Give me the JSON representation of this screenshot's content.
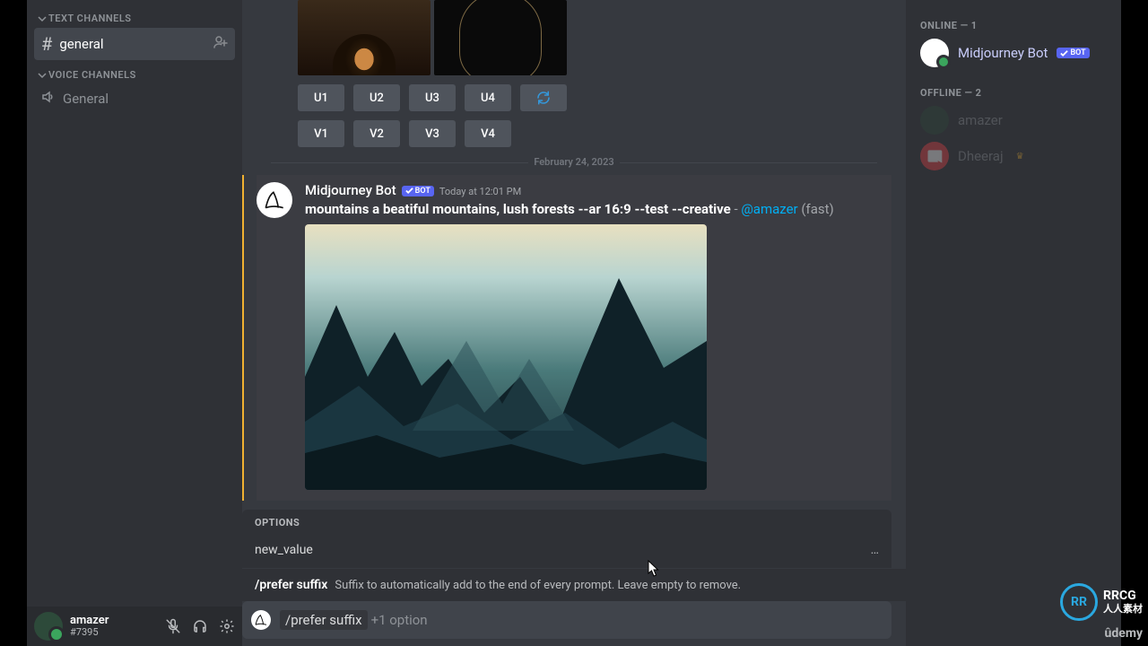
{
  "sidebar": {
    "text_channels_label": "TEXT CHANNELS",
    "voice_channels_label": "VOICE CHANNELS",
    "text": [
      {
        "name": "general",
        "active": true
      }
    ],
    "voice": [
      {
        "name": "General"
      }
    ]
  },
  "buttons": {
    "u": [
      "U1",
      "U2",
      "U3",
      "U4"
    ],
    "v": [
      "V1",
      "V2",
      "V3",
      "V4"
    ]
  },
  "divider_date": "February 24, 2023",
  "message": {
    "author": "Midjourney Bot",
    "bot_label": "BOT",
    "timestamp": "Today at 12:01 PM",
    "prompt": "mountains a beatiful mountains, lush forests --ar 16:9 --test --creative",
    "sep": " - ",
    "mention": "@amazer",
    "mode": " (fast)"
  },
  "options": {
    "header": "OPTIONS",
    "item": "new_value",
    "dots": "…",
    "cmd": "/prefer suffix",
    "desc": "Suffix to automatically add to the end of every prompt. Leave empty to remove."
  },
  "input": {
    "typed": "/prefer suffix",
    "extra": "+1 option"
  },
  "userbar": {
    "name": "amazer",
    "tag": "#7395"
  },
  "members": {
    "online_label": "ONLINE — 1",
    "offline_label": "OFFLINE — 2",
    "online": [
      {
        "name": "Midjourney Bot",
        "bot": true,
        "bot_label": "BOT"
      }
    ],
    "offline": [
      {
        "name": "amazer"
      },
      {
        "name": "Dheeraj",
        "crown": true
      }
    ]
  },
  "watermark": {
    "rrcg_cn": "人人素材",
    "udemy": "ûdemy"
  }
}
